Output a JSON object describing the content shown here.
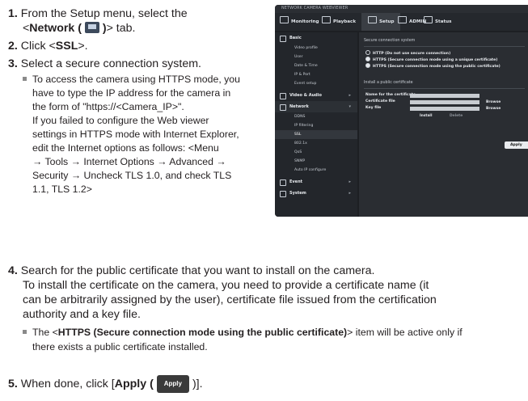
{
  "steps": {
    "s1_num": "1.",
    "s1_a": "From the Setup menu, select the",
    "s1_b_pre": "<",
    "s1_b_bold": "Network (",
    "s1_b_bold2": ")",
    "s1_b_post": "> tab.",
    "s2_num": "2.",
    "s2_pre": "Click <",
    "s2_bold": "SSL",
    "s2_post": ">.",
    "s3_num": "3.",
    "s3": "Select a secure connection system.",
    "s3_bullet": [
      "To access the camera using HTTPS mode, you",
      "have to type the IP address for the camera in",
      "the form of \"https://<Camera_IP>\".",
      "If you failed to configure the Web viewer",
      "settings in HTTPS mode with Internet Explorer,",
      "edit the Internet options as follows: <Menu",
      "→ Tools → Internet Options → Advanced →",
      "Security → Uncheck TLS 1.0, and check TLS",
      "1.1, TLS 1.2>"
    ],
    "s4_num": "4.",
    "s4_lines": [
      "Search for the public certificate that you want to install on the camera.",
      "To install the certificate on the camera, you need to provide a certificate name (it",
      "can be arbitrarily assigned by the user), certificate file issued from the certification",
      "authority and a key file."
    ],
    "s4_bullet_pre": "The <",
    "s4_bullet_bold": "HTTPS (Secure connection mode using the public certificate)",
    "s4_bullet_post": "> item will be active only if",
    "s4_bullet_line2": "there exists a public certificate installed.",
    "s5_num": "5.",
    "s5_pre": "When done, click [",
    "s5_bold": "Apply (",
    "s5_chip": "Apply",
    "s5_post": ")]."
  },
  "screenshot": {
    "title": "NETWORK CAMERA WEBVIEWER",
    "tabs": {
      "monitoring": "Monitoring",
      "playback": "Playback",
      "setup": "Setup",
      "admin": "ADMIN",
      "status": "Status"
    },
    "sidebar": {
      "basic": "Basic",
      "basic_items": [
        "Video profile",
        "User",
        "Date & Time",
        "IP & Port",
        "Event setup"
      ],
      "video_audio": "Video & Audio",
      "network": "Network",
      "network_items": [
        "DDNS",
        "IP filtering",
        "SSL",
        "802.1x",
        "QoS",
        "SNMP",
        "Auto IP configure"
      ],
      "event": "Event",
      "system": "System"
    },
    "main": {
      "secure_title": "Secure connection system",
      "radios": [
        "HTTP (Do not use secure connection)",
        "HTTPS (Secure connection mode using a unique certificate)",
        "HTTPS (Secure connection mode using the public certificate)"
      ],
      "install_title": "Install a public certificate",
      "name_label": "Name for the certificate",
      "file_label": "Certificate file",
      "key_label": "Key file",
      "browse1": "Browse",
      "browse2": "Browse",
      "install": "Install",
      "delete": "Delete",
      "apply": "Apply"
    }
  }
}
